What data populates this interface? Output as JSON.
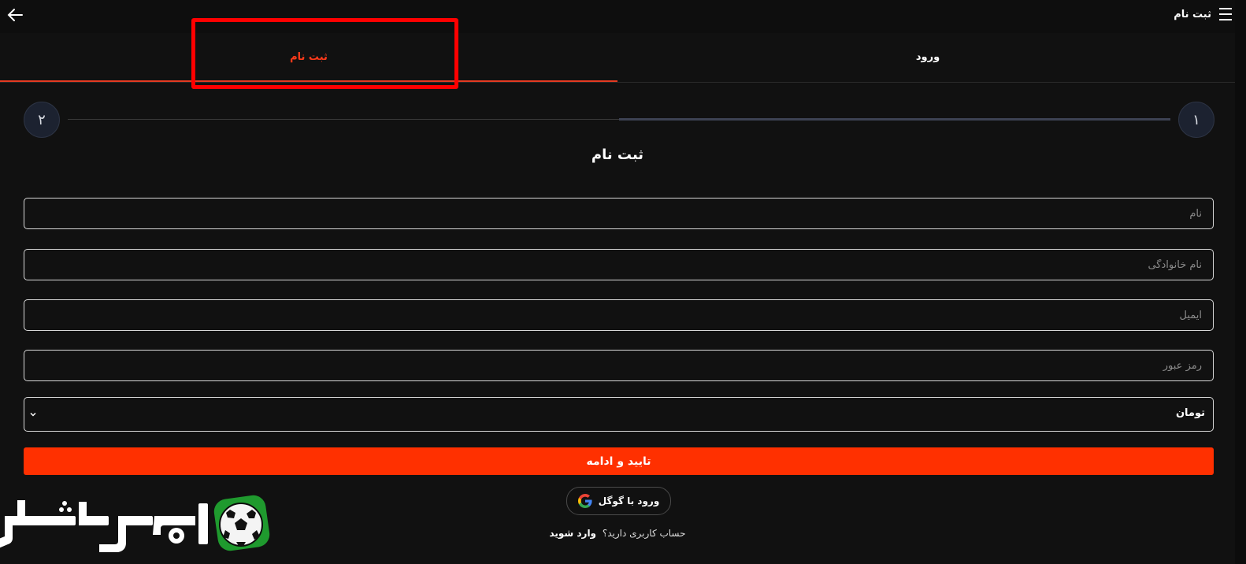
{
  "header": {
    "title": "ثبت نام",
    "back_icon": "arrow-left-icon",
    "menu_icon": "hamburger-icon"
  },
  "tabs": [
    {
      "label": "ثبت نام",
      "active": true
    },
    {
      "label": "ورود",
      "active": false
    }
  ],
  "stepper": {
    "step1": "۱",
    "step2": "۲",
    "current": 1
  },
  "form": {
    "title": "ثبت نام",
    "fields": [
      {
        "placeholder": "نام",
        "value": ""
      },
      {
        "placeholder": "نام خانوادگی",
        "value": ""
      },
      {
        "placeholder": "ایمیل",
        "value": ""
      },
      {
        "placeholder": "رمز عبور",
        "value": ""
      }
    ],
    "currency": {
      "selected": "تومان"
    },
    "submit_label": "تایید و ادامه",
    "google_label": "ورود با گوگل",
    "have_account_text": "حساب کاربری دارید؟",
    "login_link": "وارد شوید"
  },
  "colors": {
    "background": "#111111",
    "accent": "#ff3000",
    "active_tab": "#e53b22",
    "highlight": "#ff0000"
  },
  "logo": {
    "text": "اسپورت‌شرط",
    "icon": "soccer-ball-icon"
  }
}
